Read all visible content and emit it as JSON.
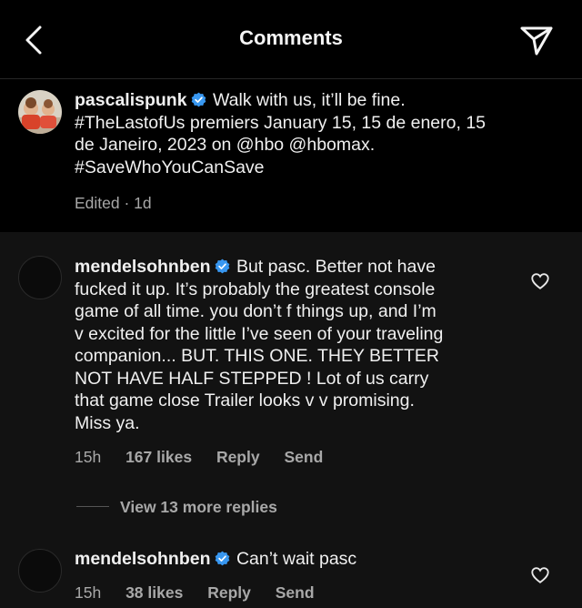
{
  "header": {
    "title": "Comments",
    "back_icon": "chevron-left-icon",
    "share_icon": "paper-plane-icon"
  },
  "caption": {
    "username": "pascalispunk",
    "lines": [
      "Walk with us, it’ll be fine.",
      "#TheLastofUs premiers January 15, 15 de enero, 15",
      "de Janeiro, 2023 on @hbo @hbomax.",
      "#SaveWhoYouCanSave"
    ],
    "edited": "Edited · 1d"
  },
  "comments": [
    {
      "username": "mendelsohnben",
      "lines": [
        "But pasc. Better not have",
        "fucked it up.  It’s probably the greatest console",
        "game of all time.  you don’t f things up, and I’m",
        "v excited for the little I’ve seen of your traveling",
        "companion... BUT.  THIS ONE.  THEY BETTER",
        "NOT HAVE HALF STEPPED !  Lot of us carry",
        "that game close  Trailer looks v v promising.",
        "Miss ya."
      ],
      "time": "15h",
      "likes": "167 likes",
      "reply": "Reply",
      "send": "Send"
    },
    {
      "username": "mendelsohnben",
      "lines": [
        "Can’t wait pasc"
      ],
      "time": "15h",
      "likes": "38 likes",
      "reply": "Reply",
      "send": "Send"
    }
  ],
  "view_more_replies": "View 13 more replies",
  "colors": {
    "background": "#000000",
    "comment_background": "#121212",
    "text": "#f5f5f5",
    "secondary": "#a8a8a8",
    "verified": "#3897f0"
  }
}
